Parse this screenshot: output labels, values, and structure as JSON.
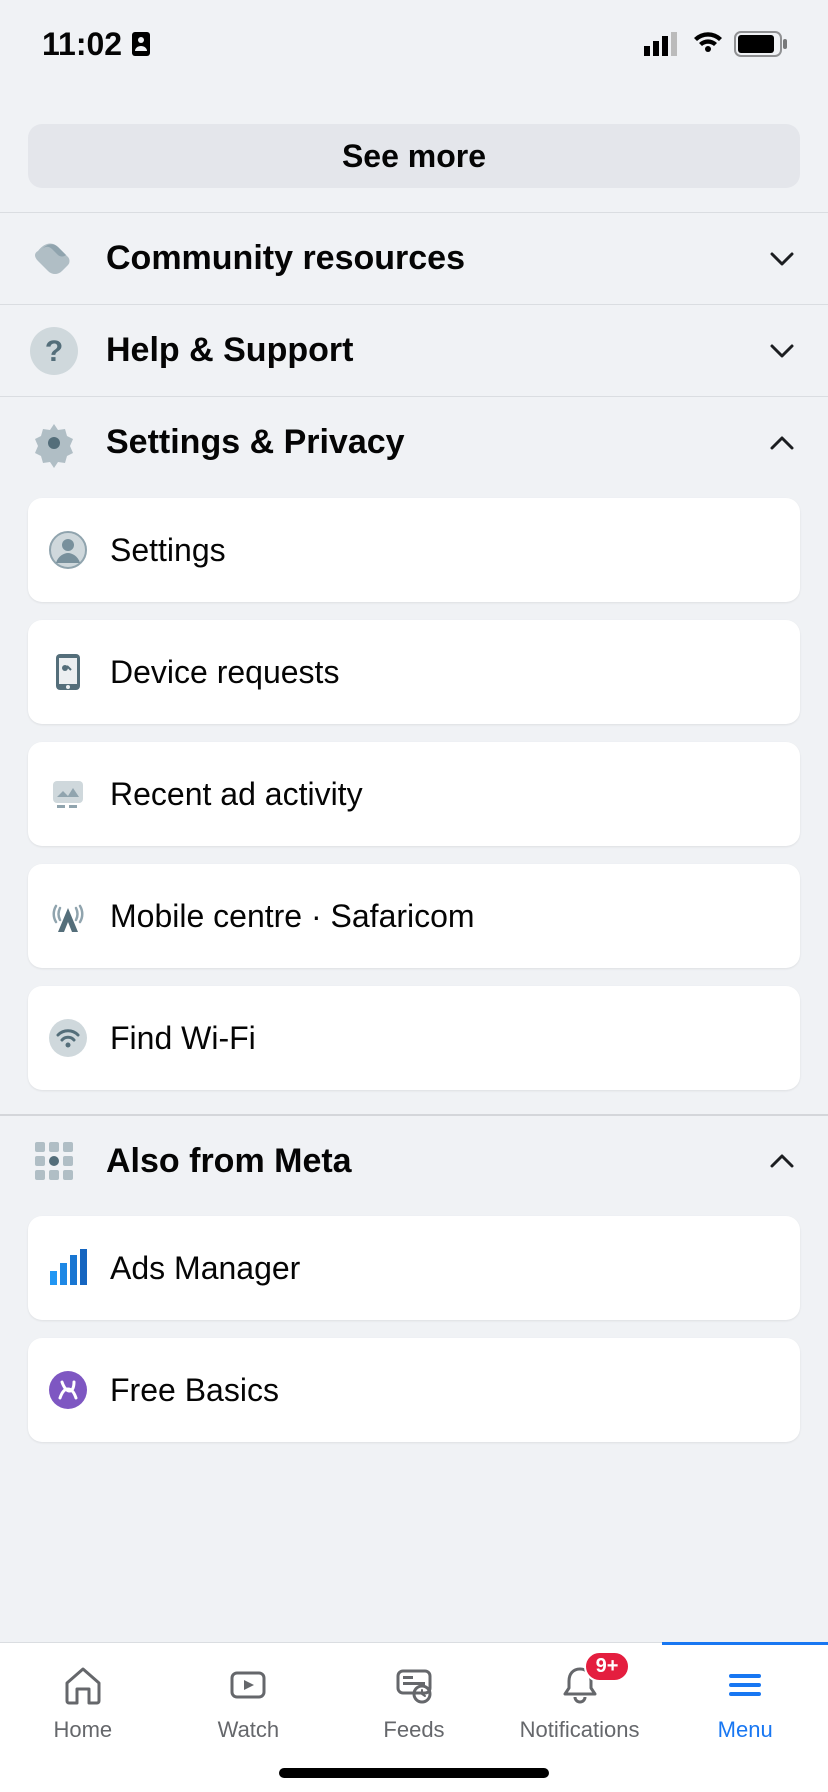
{
  "statusBar": {
    "time": "11:02"
  },
  "seeMore": {
    "label": "See more"
  },
  "community": {
    "label": "Community resources",
    "expanded": false
  },
  "help": {
    "label": "Help & Support",
    "expanded": false
  },
  "settingsPrivacy": {
    "label": "Settings & Privacy",
    "expanded": true,
    "items": [
      {
        "id": "settings",
        "label": "Settings"
      },
      {
        "id": "device-requests",
        "label": "Device requests"
      },
      {
        "id": "recent-ad-activity",
        "label": "Recent ad activity"
      },
      {
        "id": "mobile-centre",
        "label": "Mobile centre · Safaricom"
      },
      {
        "id": "find-wifi",
        "label": "Find Wi-Fi"
      }
    ]
  },
  "alsoFromMeta": {
    "label": "Also from Meta",
    "expanded": true,
    "items": [
      {
        "id": "ads-manager",
        "label": "Ads Manager"
      },
      {
        "id": "free-basics",
        "label": "Free Basics"
      }
    ]
  },
  "tabs": {
    "home": "Home",
    "watch": "Watch",
    "feeds": "Feeds",
    "notifications": "Notifications",
    "notificationsBadge": "9+",
    "menu": "Menu"
  }
}
